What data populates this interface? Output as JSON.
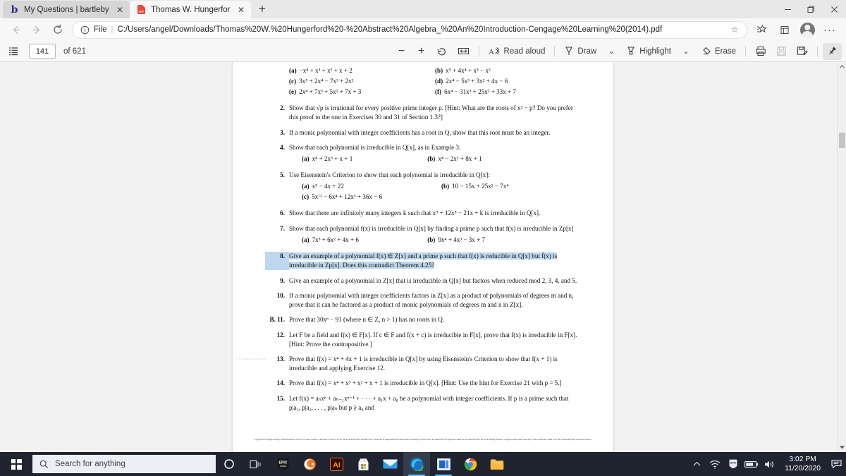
{
  "window": {
    "controls": {
      "minimize": "—",
      "maximize": "❐",
      "close": "✕"
    }
  },
  "tabs": [
    {
      "title": "My Questions | bartleby",
      "favicon": "bartleby-b-icon",
      "active": false,
      "close": "✕"
    },
    {
      "title": "Thomas W. Hungerford - Abstrac",
      "favicon": "pdf-file-icon",
      "active": true,
      "close": "✕"
    }
  ],
  "new_tab_label": "+",
  "address_bar": {
    "back": "←",
    "forward": "→",
    "reload": "↻",
    "info_icon": "info-circle-icon",
    "scheme_label": "File",
    "separator": "|",
    "url": "C:/Users/angel/Downloads/Thomas%20W.%20Hungerford%20-%20Abstract%20Algebra_%20An%20Introduction-Cengage%20Learning%20(2014).pdf",
    "favorite": "☆",
    "collections": "collections-icon",
    "extensions": "extensions-icon",
    "profile": "profile-avatar-icon",
    "settings_more": "···"
  },
  "pdf_toolbar": {
    "sidebar_toggle": "table-of-contents-icon",
    "page_number": "141",
    "page_total": "of 621",
    "zoom_out": "−",
    "zoom_in": "+",
    "rotate": "rotate-icon",
    "fit_page": "fit-page-icon",
    "read_aloud": "Read aloud",
    "draw": "Draw",
    "draw_caret": "⌄",
    "highlight": "Highlight",
    "highlight_caret": "⌄",
    "erase": "Erase",
    "print": "print-icon",
    "save": "save-icon",
    "save_as": "save-as-icon",
    "pin": "pin-icon"
  },
  "document": {
    "exercises": [
      {
        "number": "",
        "subparts": [
          {
            "label": "(a)",
            "text": "−x⁴ + x³ + x² + x + 2"
          },
          {
            "label": "(b)",
            "text": "x⁵ + 4x⁴ + x³ − x²"
          },
          {
            "label": "(c)",
            "text": "3x⁵ + 2x⁴ − 7x³ + 2x²"
          },
          {
            "label": "(d)",
            "text": "2x⁴ − 5x³ + 3x² + 4x − 6"
          },
          {
            "label": "(e)",
            "text": "2x⁴ + 7x³ + 5x² + 7x + 3"
          },
          {
            "label": "(f)",
            "text": "6x⁴ − 31x³ + 25x² + 33x + 7"
          }
        ]
      },
      {
        "number": "2.",
        "text": "Show that √p is irrational for every positive prime integer p. [Hint: What are the roots of x² − p? Do you prefer this proof to the one in Exercises 30 and 31 of Section 1.3?]"
      },
      {
        "number": "3.",
        "text": "If a monic polynomial with integer coefficients has a root in Q, show that this root must be an integer."
      },
      {
        "number": "4.",
        "text": "Show that each polynomial is irreducible in Q[x], as in Example 3.",
        "subparts": [
          {
            "label": "(a)",
            "text": "x⁴ + 2x³ + x + 1"
          },
          {
            "label": "(b)",
            "text": "x⁴ − 2x² + 8x + 1"
          }
        ]
      },
      {
        "number": "5.",
        "text": "Use Eisenstein's Criterion to show that each polynomial is irreducible in Q[x]:",
        "subparts": [
          {
            "label": "(a)",
            "text": "x⁵ − 4x + 22"
          },
          {
            "label": "(b)",
            "text": "10 − 15x + 25x² − 7x⁴"
          },
          {
            "label": "(c)",
            "text": "5x¹¹ − 6x⁴ + 12x³ + 36x − 6"
          }
        ]
      },
      {
        "number": "6.",
        "text": "Show that there are infinitely many integers k such that x⁹ + 12x⁵ − 21x + k is irreducible in Q[x]."
      },
      {
        "number": "7.",
        "text": "Show that each polynomial f(x) is irreducible in Q[x] by finding a prime p such that f(x) is irreducible in Zp[x]",
        "subparts": [
          {
            "label": "(a)",
            "text": "7x³ + 6x² + 4x + 6"
          },
          {
            "label": "(b)",
            "text": "9x⁴ + 4x³ − 3x + 7"
          }
        ]
      },
      {
        "number": "8.",
        "text": "Give an example of a polynomial f(x) ∈ Z[x] and a prime p such that f(x) is reducible in Q[x] but f̄(x) is irreducible in Zp[x]. Does this contradict Theorem 4.25?",
        "highlighted": true
      },
      {
        "number": "9.",
        "text": "Give an example of a polynomial in Z[x] that is irreducible in Q[x] but factors when reduced mod 2, 3, 4, and 5."
      },
      {
        "number": "10.",
        "text": "If a monic polynomial with integer coefficients factors in Z[x] as a product of polynomials of degrees m and n, prove that it can be factored as a product of monic polynomials of degrees m and n in Z[x]."
      },
      {
        "number": "B. 11.",
        "text": "Prove that 30xⁿ − 91 (where n ∈ Z, n > 1) has no roots in Q."
      },
      {
        "number": "12.",
        "text": "Let F be a field and f(x) ∈ F[x]. If c ∈ F and f(x + c) is irreducible in F[x], prove that f(x) is irreducible in F[x]. [Hint: Prove the contrapositive.]"
      },
      {
        "number": "13.",
        "text": "Prove that f(x) = x⁴ + 4x + 1 is irreducible in Q[x] by using Eisenstein's Criterion to show that f(x + 1) is irreducible and applying Exercise 12."
      },
      {
        "number": "14.",
        "text": "Prove that f(x) = x⁴ + x³ + x² + x + 1 is irreducible in Q[x]. [Hint: Use the hint for Exercise 21 with p = 5.]"
      },
      {
        "number": "15.",
        "text": "Let f(x) = aₙxⁿ + aₙ₋₁xⁿ⁻¹ + · · · + a₁x + a₀ be a polynomial with integer coefficients. If p is a prime such that p|a₁, p|a₂, . . . , p|aₙ but p ∤ a₀ and"
      }
    ],
    "watermark": "© Cengage Learning",
    "copyright_notice": "Copyright 2013 Cengage Learning. All Rights Reserved. May not be copied, scanned, or duplicated, in whole or in part. Due to electronic rights, some third party content may be suppressed from the eBook and/or eChapter(s). Editorial review has deemed that any suppressed content does not materially affect the overall learning experience. Cengage Learning reserves the right to remove additional content at any time if subsequent rights restrictions require it."
  },
  "taskbar": {
    "start": "windows-start-icon",
    "search_placeholder": "Search for anything",
    "cortana": "cortana-icon",
    "task_view": "task-view-icon",
    "apps": [
      {
        "name": "epic-games-icon",
        "label": "EPIC"
      },
      {
        "name": "crunchyroll-icon",
        "label": ""
      },
      {
        "name": "adobe-illustrator-icon",
        "label": "Ai"
      },
      {
        "name": "microsoft-store-icon",
        "label": ""
      },
      {
        "name": "mail-icon",
        "label": ""
      },
      {
        "name": "microsoft-edge-icon",
        "label": ""
      },
      {
        "name": "blue-app-icon",
        "label": ""
      },
      {
        "name": "google-chrome-icon",
        "label": ""
      },
      {
        "name": "file-explorer-icon",
        "label": ""
      }
    ],
    "tray": {
      "show_hidden": "^",
      "wifi": "wifi-icon",
      "epic": "epic-tray-icon",
      "battery": "battery-icon",
      "volume": "volume-icon",
      "time": "3:02 PM",
      "date": "11/20/2020",
      "notifications": "action-center-icon"
    }
  }
}
